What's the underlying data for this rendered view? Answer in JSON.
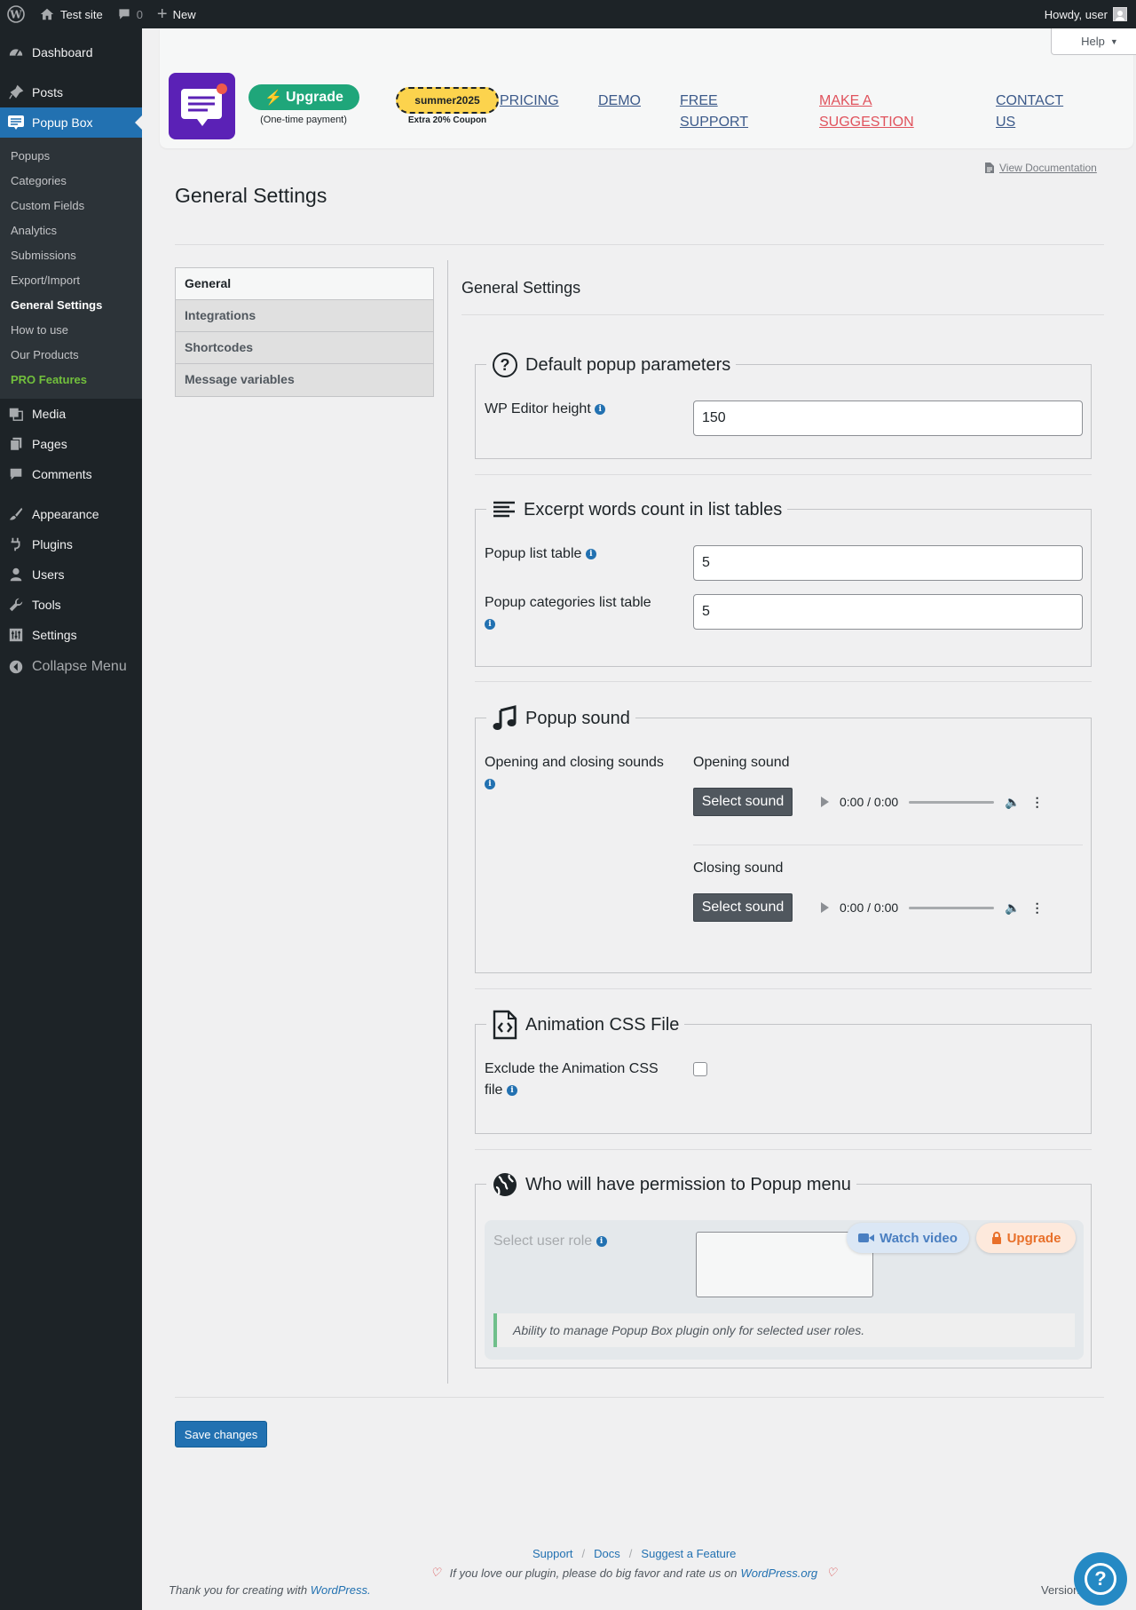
{
  "adminbar": {
    "site_name": "Test site",
    "comments_count": "0",
    "new_label": "New",
    "howdy": "Howdy, user"
  },
  "sidebar": {
    "items_top": [
      {
        "label": "Dashboard",
        "icon": "dashboard-icon"
      },
      {
        "label": "Posts",
        "icon": "pin-icon"
      },
      {
        "label": "Popup Box",
        "icon": "popup-icon"
      }
    ],
    "submenu": [
      "Popups",
      "Categories",
      "Custom Fields",
      "Analytics",
      "Submissions",
      "Export/Import",
      "General Settings",
      "How to use",
      "Our Products",
      "PRO Features"
    ],
    "items_bottom": [
      {
        "label": "Media"
      },
      {
        "label": "Pages"
      },
      {
        "label": "Comments"
      },
      {
        "label": "Appearance"
      },
      {
        "label": "Plugins"
      },
      {
        "label": "Users"
      },
      {
        "label": "Tools"
      },
      {
        "label": "Settings"
      }
    ],
    "collapse": "Collapse Menu"
  },
  "header": {
    "help": "Help",
    "upgrade": "Upgrade",
    "one_time": "(One-time payment)",
    "coupon": "summer2025",
    "coupon_sub": "Extra 20% Coupon",
    "nav": {
      "pricing": "PRICING",
      "demo": "DEMO",
      "free_support_1": "FREE",
      "free_support_2": "SUPPORT",
      "suggest_1": "MAKE A",
      "suggest_2": "SUGGESTION",
      "contact_1": "CONTACT",
      "contact_2": "US"
    },
    "view_docs": "View Documentation"
  },
  "page_title": "General Settings",
  "tabs": [
    "General",
    "Integrations",
    "Shortcodes",
    "Message variables"
  ],
  "section_title": "General Settings",
  "default_params": {
    "legend": "Default popup parameters",
    "wp_editor_label": "WP Editor height",
    "wp_editor_value": "150"
  },
  "excerpt": {
    "legend": "Excerpt words count in list tables",
    "popup_list_label": "Popup list table",
    "popup_list_value": "5",
    "categories_label": "Popup categories list table",
    "categories_value": "5"
  },
  "sound": {
    "legend": "Popup sound",
    "label": "Opening and closing sounds",
    "opening_title": "Opening sound",
    "closing_title": "Closing sound",
    "select_button": "Select sound",
    "time": "0:00 / 0:00"
  },
  "animation": {
    "legend": "Animation CSS File",
    "label_1": "Exclude the Animation CSS",
    "label_2": "file"
  },
  "permission": {
    "legend": "Who will have permission to Popup menu",
    "watch_video": "Watch video",
    "upgrade": "Upgrade",
    "select_label": "Select user role",
    "note": "Ability to manage Popup Box plugin only for selected user roles."
  },
  "save": "Save changes",
  "footer": {
    "support": "Support",
    "docs": "Docs",
    "suggest": "Suggest a Feature",
    "rate_text": "If you love our plugin, please do big favor and rate us on",
    "rate_link": "WordPress.org",
    "thanks": "Thank you for creating with",
    "thanks_link": "WordPress.",
    "version": "Version"
  },
  "colors": {
    "admin_bg": "#1d2327",
    "accent": "#2271b1",
    "upgrade_green": "#1fa67a",
    "pro_green": "#72c03c",
    "coupon_yellow": "#fcd34d",
    "suggestion_red": "#e0535d",
    "logo_purple": "#5b21b6"
  }
}
